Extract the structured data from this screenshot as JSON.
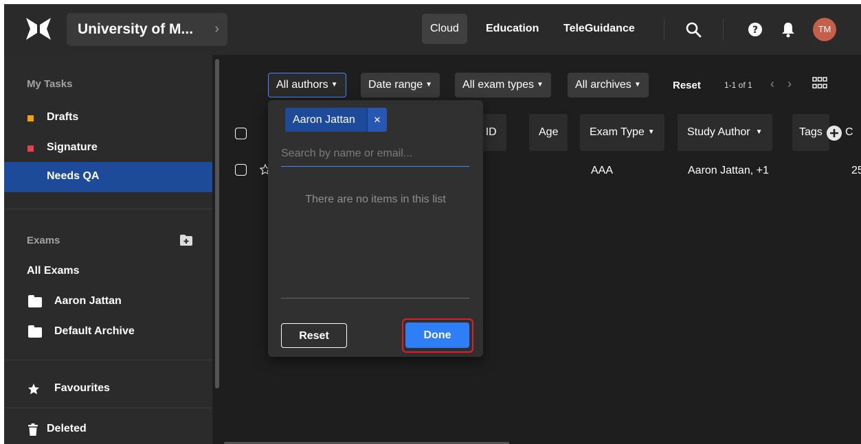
{
  "topbar": {
    "org_name": "University of M...",
    "nav": [
      "Cloud",
      "Education",
      "TeleGuidance"
    ],
    "avatar": "TM"
  },
  "sidebar": {
    "my_tasks": "My Tasks",
    "tasks": [
      {
        "label": "Drafts",
        "color": "#f0a30a"
      },
      {
        "label": "Signature",
        "color": "#e5414f"
      },
      {
        "label": "Needs QA",
        "active": true
      }
    ],
    "exams_heading": "Exams",
    "all_exams": "All Exams",
    "folders": [
      "Aaron Jattan",
      "Default Archive"
    ],
    "favourites": "Favourites",
    "deleted": "Deleted"
  },
  "filters": {
    "authors": "All authors",
    "date": "Date range",
    "exam_types": "All exam types",
    "archives": "All archives",
    "reset": "Reset",
    "pager": "1-1 of 1"
  },
  "table": {
    "headers": [
      "ent ID",
      "Age",
      "Exam Type",
      "Study Author",
      "Tags",
      "C"
    ],
    "row": {
      "exam_type": "AAA",
      "study_author": "Aaron Jattan, +1",
      "last": "25"
    }
  },
  "author_dropdown": {
    "selected": "Aaron Jattan",
    "search_placeholder": "Search by name or email...",
    "empty_text": "There are no items in this list",
    "reset_label": "Reset",
    "done_label": "Done"
  }
}
